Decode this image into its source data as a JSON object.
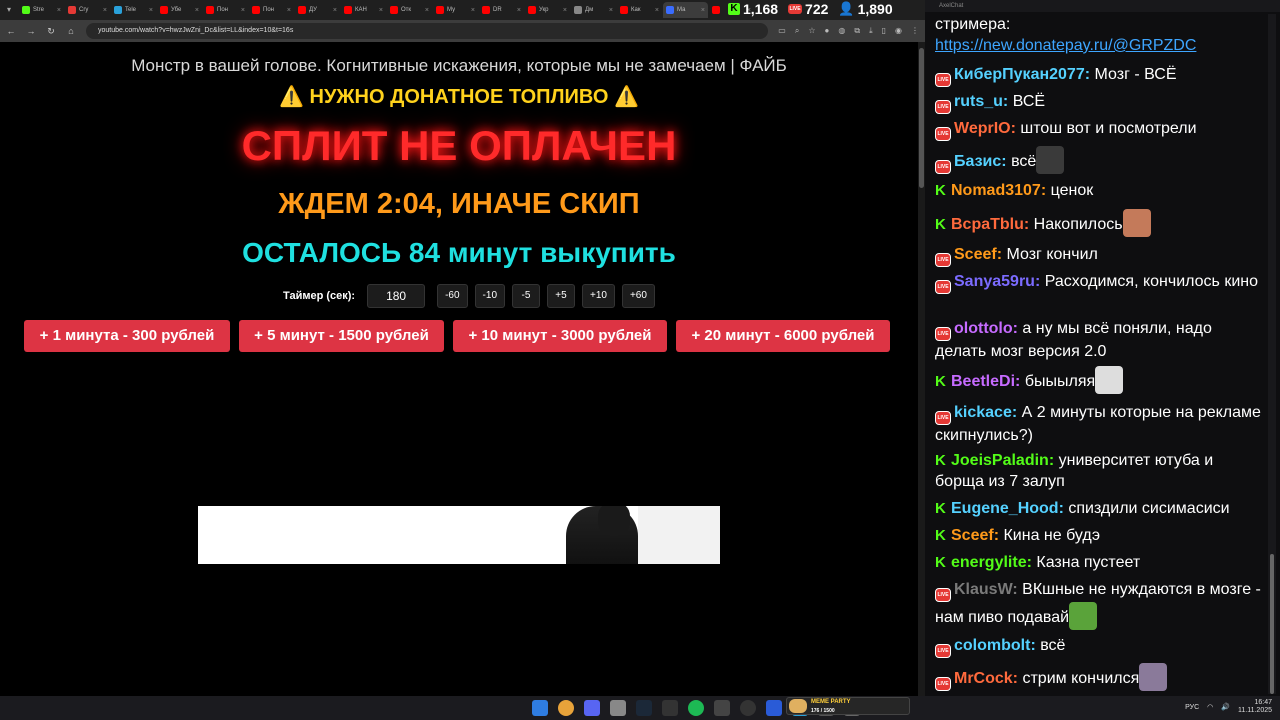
{
  "browser": {
    "tabs": [
      {
        "label": "Stre",
        "color": "#53fc18"
      },
      {
        "label": "Cry",
        "color": "#e53935"
      },
      {
        "label": "Tele",
        "color": "#2aa1da"
      },
      {
        "label": "Убе",
        "color": "#ff0000"
      },
      {
        "label": "Пон",
        "color": "#ff0000"
      },
      {
        "label": "Пон",
        "color": "#ff0000"
      },
      {
        "label": "ДУ",
        "color": "#ff0000"
      },
      {
        "label": "КАН",
        "color": "#ff0000"
      },
      {
        "label": "Отк",
        "color": "#ff0000"
      },
      {
        "label": "Му",
        "color": "#ff0000"
      },
      {
        "label": "DR",
        "color": "#ff0000"
      },
      {
        "label": "Укр",
        "color": "#ff0000"
      },
      {
        "label": "Дм",
        "color": "#888888"
      },
      {
        "label": "Как",
        "color": "#ff0000"
      },
      {
        "label": "Ма",
        "color": "#3a6cff"
      },
      {
        "label": "",
        "color": "#ff0000"
      }
    ],
    "url": "youtube.com/watch?v=hwzJwZni_Dc&list=LL&index=10&t=16s"
  },
  "counters": {
    "kick_viewers": "1,168",
    "live_viewers": "722",
    "total_viewers": "1,890"
  },
  "overlay": {
    "video_title": "Монстр в вашей голове. Когнитивные искажения, которые мы не замечаем | ФАЙБ",
    "fuel_text": "НУЖНО ДОНАТНОЕ ТОПЛИВО",
    "warn_icon": "⚠️",
    "split_text": "СПЛИТ НЕ ОПЛАЧЕН",
    "wait_text": "ЖДЕМ 2:04, ИНАЧЕ СКИП",
    "remain_text": "ОСТАЛОСЬ 84 минут выкупить",
    "timer_label": "Таймер (сек):",
    "timer_value": "180",
    "timer_buttons": [
      "-60",
      "-10",
      "-5",
      "+5",
      "+10",
      "+60"
    ],
    "price_buttons": [
      "+ 1 минута - 300 рублей",
      "+ 5 минут - 1500 рублей",
      "+ 10 минут - 3000 рублей",
      "+ 20 минут - 6000 рублей"
    ]
  },
  "chat": {
    "header": "AxelChat",
    "first_line": "стримера:",
    "first_link": "https://new.donatepay.ru/@GRPZDC",
    "messages": [
      {
        "badge": "live",
        "user": "КиберПукан2077:",
        "color": "#55d1ff",
        "text": "Мозг - ВСЁ",
        "emote": ""
      },
      {
        "badge": "live",
        "user": "ruts_u:",
        "color": "#55d1ff",
        "text": "ВСЁ",
        "emote": ""
      },
      {
        "badge": "live",
        "user": "WeprIO:",
        "color": "#ff6a3d",
        "text": "штош вот и посмотрели",
        "emote": ""
      },
      {
        "badge": "live",
        "user": "Базис:",
        "color": "#55d1ff",
        "text": "всё",
        "emote": "#3a3a3a"
      },
      {
        "badge": "kick",
        "user": "Nomad3107:",
        "color": "#ff9a1a",
        "text": "ценок",
        "emote": ""
      },
      {
        "badge": "kick",
        "user": "ВсраТblu:",
        "color": "#ff6a3d",
        "text": "Накопилось",
        "emote": "#c47a5a"
      },
      {
        "badge": "live",
        "user": "Sceef:",
        "color": "#ff9a1a",
        "text": "Мозг кончил",
        "emote": ""
      },
      {
        "badge": "live",
        "user": "Sanya59ru:",
        "color": "#7b6bff",
        "text": "Расходимся, кончилось кино",
        "emote": ""
      },
      {
        "badge": "live",
        "user": "olottolo:",
        "color": "#c66bff",
        "text": "а ну мы всё поняли, надо делать мозг версия 2.0",
        "emote": ""
      },
      {
        "badge": "kick",
        "user": "BeetleDi:",
        "color": "#c66bff",
        "text": "быыыляя",
        "emote": "#dddddd"
      },
      {
        "badge": "live",
        "user": "kickace:",
        "color": "#55d1ff",
        "text": "А 2 минуты которые на рекламе скипнулись?)",
        "emote": ""
      },
      {
        "badge": "kick",
        "user": "JoeisPaladin:",
        "color": "#53fc18",
        "text": "университет ютуба и борща из 7 залуп",
        "emote": ""
      },
      {
        "badge": "kick",
        "user": "Eugene_Hood:",
        "color": "#55d1ff",
        "text": "спиздили сисимасиси",
        "emote": ""
      },
      {
        "badge": "kick",
        "user": "Sceef:",
        "color": "#ff9a1a",
        "text": "Кина не будэ",
        "emote": ""
      },
      {
        "badge": "kick",
        "user": "energylite:",
        "color": "#53fc18",
        "text": "Казна пустеет",
        "emote": ""
      },
      {
        "badge": "live",
        "user": "KlausW:",
        "color": "#7a7a7a",
        "text": "ВКшные не нуждаются в мозге - нам пиво подавай",
        "emote": "#5aa33a"
      },
      {
        "badge": "live",
        "user": "colombolt:",
        "color": "#55d1ff",
        "text": "всё",
        "emote": ""
      },
      {
        "badge": "live",
        "user": "MrCock:",
        "color": "#ff6a3d",
        "text": "стрим кончился",
        "emote": "#8a7a9a"
      }
    ]
  },
  "taskbar": {
    "meme_title": "MEME PARTY",
    "meme_value": "176 / 1500",
    "lang": "РУС",
    "time": "16:47",
    "date": "11.11.2025"
  }
}
